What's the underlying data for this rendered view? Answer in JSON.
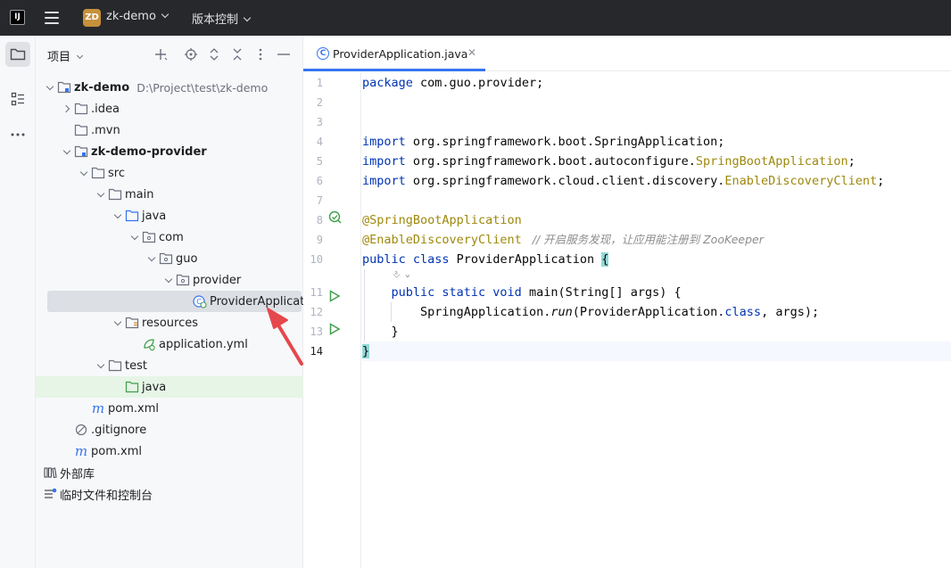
{
  "titlebar": {
    "logo_text": "IJ",
    "project_badge": "ZD",
    "project_name": "zk-demo",
    "vcs_label": "版本控制"
  },
  "project_panel": {
    "title": "项目",
    "tree": [
      {
        "label": "zk-demo",
        "path": "D:\\Project\\test\\zk-demo",
        "level": 0,
        "arrow": "down",
        "icon": "folder-module-icon",
        "bold": true
      },
      {
        "label": ".idea",
        "level": 1,
        "arrow": "right",
        "icon": "folder-icon"
      },
      {
        "label": ".mvn",
        "level": 1,
        "arrow": "none",
        "icon": "folder-icon"
      },
      {
        "label": "zk-demo-provider",
        "level": 1,
        "arrow": "down",
        "icon": "folder-module-icon",
        "bold": true
      },
      {
        "label": "src",
        "level": 2,
        "arrow": "down",
        "icon": "folder-icon"
      },
      {
        "label": "main",
        "level": 3,
        "arrow": "down",
        "icon": "folder-icon"
      },
      {
        "label": "java",
        "level": 4,
        "arrow": "down",
        "icon": "source-folder-icon"
      },
      {
        "label": "com",
        "level": 5,
        "arrow": "down",
        "icon": "package-icon"
      },
      {
        "label": "guo",
        "level": 6,
        "arrow": "down",
        "icon": "package-icon"
      },
      {
        "label": "provider",
        "level": 7,
        "arrow": "down",
        "icon": "package-icon"
      },
      {
        "label": "ProviderApplication",
        "level": 8,
        "arrow": "none",
        "icon": "spring-class-icon",
        "selected": true
      },
      {
        "label": "resources",
        "level": 4,
        "arrow": "down",
        "icon": "resources-folder-icon"
      },
      {
        "label": "application.yml",
        "level": 5,
        "arrow": "none",
        "icon": "spring-config-icon"
      },
      {
        "label": "test",
        "level": 3,
        "arrow": "down",
        "icon": "folder-icon"
      },
      {
        "label": "java",
        "level": 4,
        "arrow": "none",
        "icon": "test-source-folder-icon",
        "highlight": true
      },
      {
        "label": "pom.xml",
        "level": 2,
        "arrow": "none",
        "icon": "maven-icon"
      },
      {
        "label": ".gitignore",
        "level": 1,
        "arrow": "none",
        "icon": "ignore-file-icon"
      },
      {
        "label": "pom.xml",
        "level": 1,
        "arrow": "none",
        "icon": "maven-icon"
      },
      {
        "label": "外部库",
        "level": 0,
        "arrow": "none",
        "icon": "library-icon",
        "noindent": true
      },
      {
        "label": "临时文件和控制台",
        "level": 0,
        "arrow": "none",
        "icon": "scratch-icon",
        "noindent": true
      }
    ]
  },
  "editor": {
    "tab_label": "ProviderApplication.java",
    "tab_icon_letter": "C",
    "line_numbers": [
      "1",
      "2",
      "3",
      "4",
      "5",
      "6",
      "7",
      "8",
      "9",
      "10",
      "11",
      "12",
      "13",
      "14"
    ],
    "code": {
      "l1_kw": "package",
      "l1_rest": " com.guo.provider;",
      "l4_kw": "import",
      "l4_rest": " org.springframework.boot.SpringApplication;",
      "l5_kw": "import",
      "l5_rest": " org.springframework.boot.autoconfigure.",
      "l5_ann": "SpringBootApplication",
      "l5_end": ";",
      "l6_kw": "import",
      "l6_rest": " org.springframework.cloud.client.discovery.",
      "l6_ann": "EnableDiscoveryClient",
      "l6_end": ";",
      "l8_ann": "@SpringBootApplication",
      "l9_ann": "@EnableDiscoveryClient",
      "l9_cmt": "   // 开启服务发现，让应用能注册到 ZooKeeper",
      "l10_kw": "public class",
      "l10_rest": " ProviderApplication ",
      "l10_brace": "{",
      "l11_indent": "    ",
      "l11_kw": "public static void",
      "l11_rest": " main(String[] args) {",
      "l12_indent": "        ",
      "l12_a": "SpringApplication.",
      "l12_run": "run",
      "l12_b": "(ProviderApplication.",
      "l12_kw": "class",
      "l12_c": ", args);",
      "l13": "    }",
      "l14_brace": "}"
    },
    "inlay_hint": "⎀ ⌄"
  },
  "colors": {
    "accent": "#3574f0",
    "keyword": "#0033b3",
    "annotation": "#9e880d",
    "run_green": "#3f9f4b",
    "red_arrow": "#e5484d"
  }
}
